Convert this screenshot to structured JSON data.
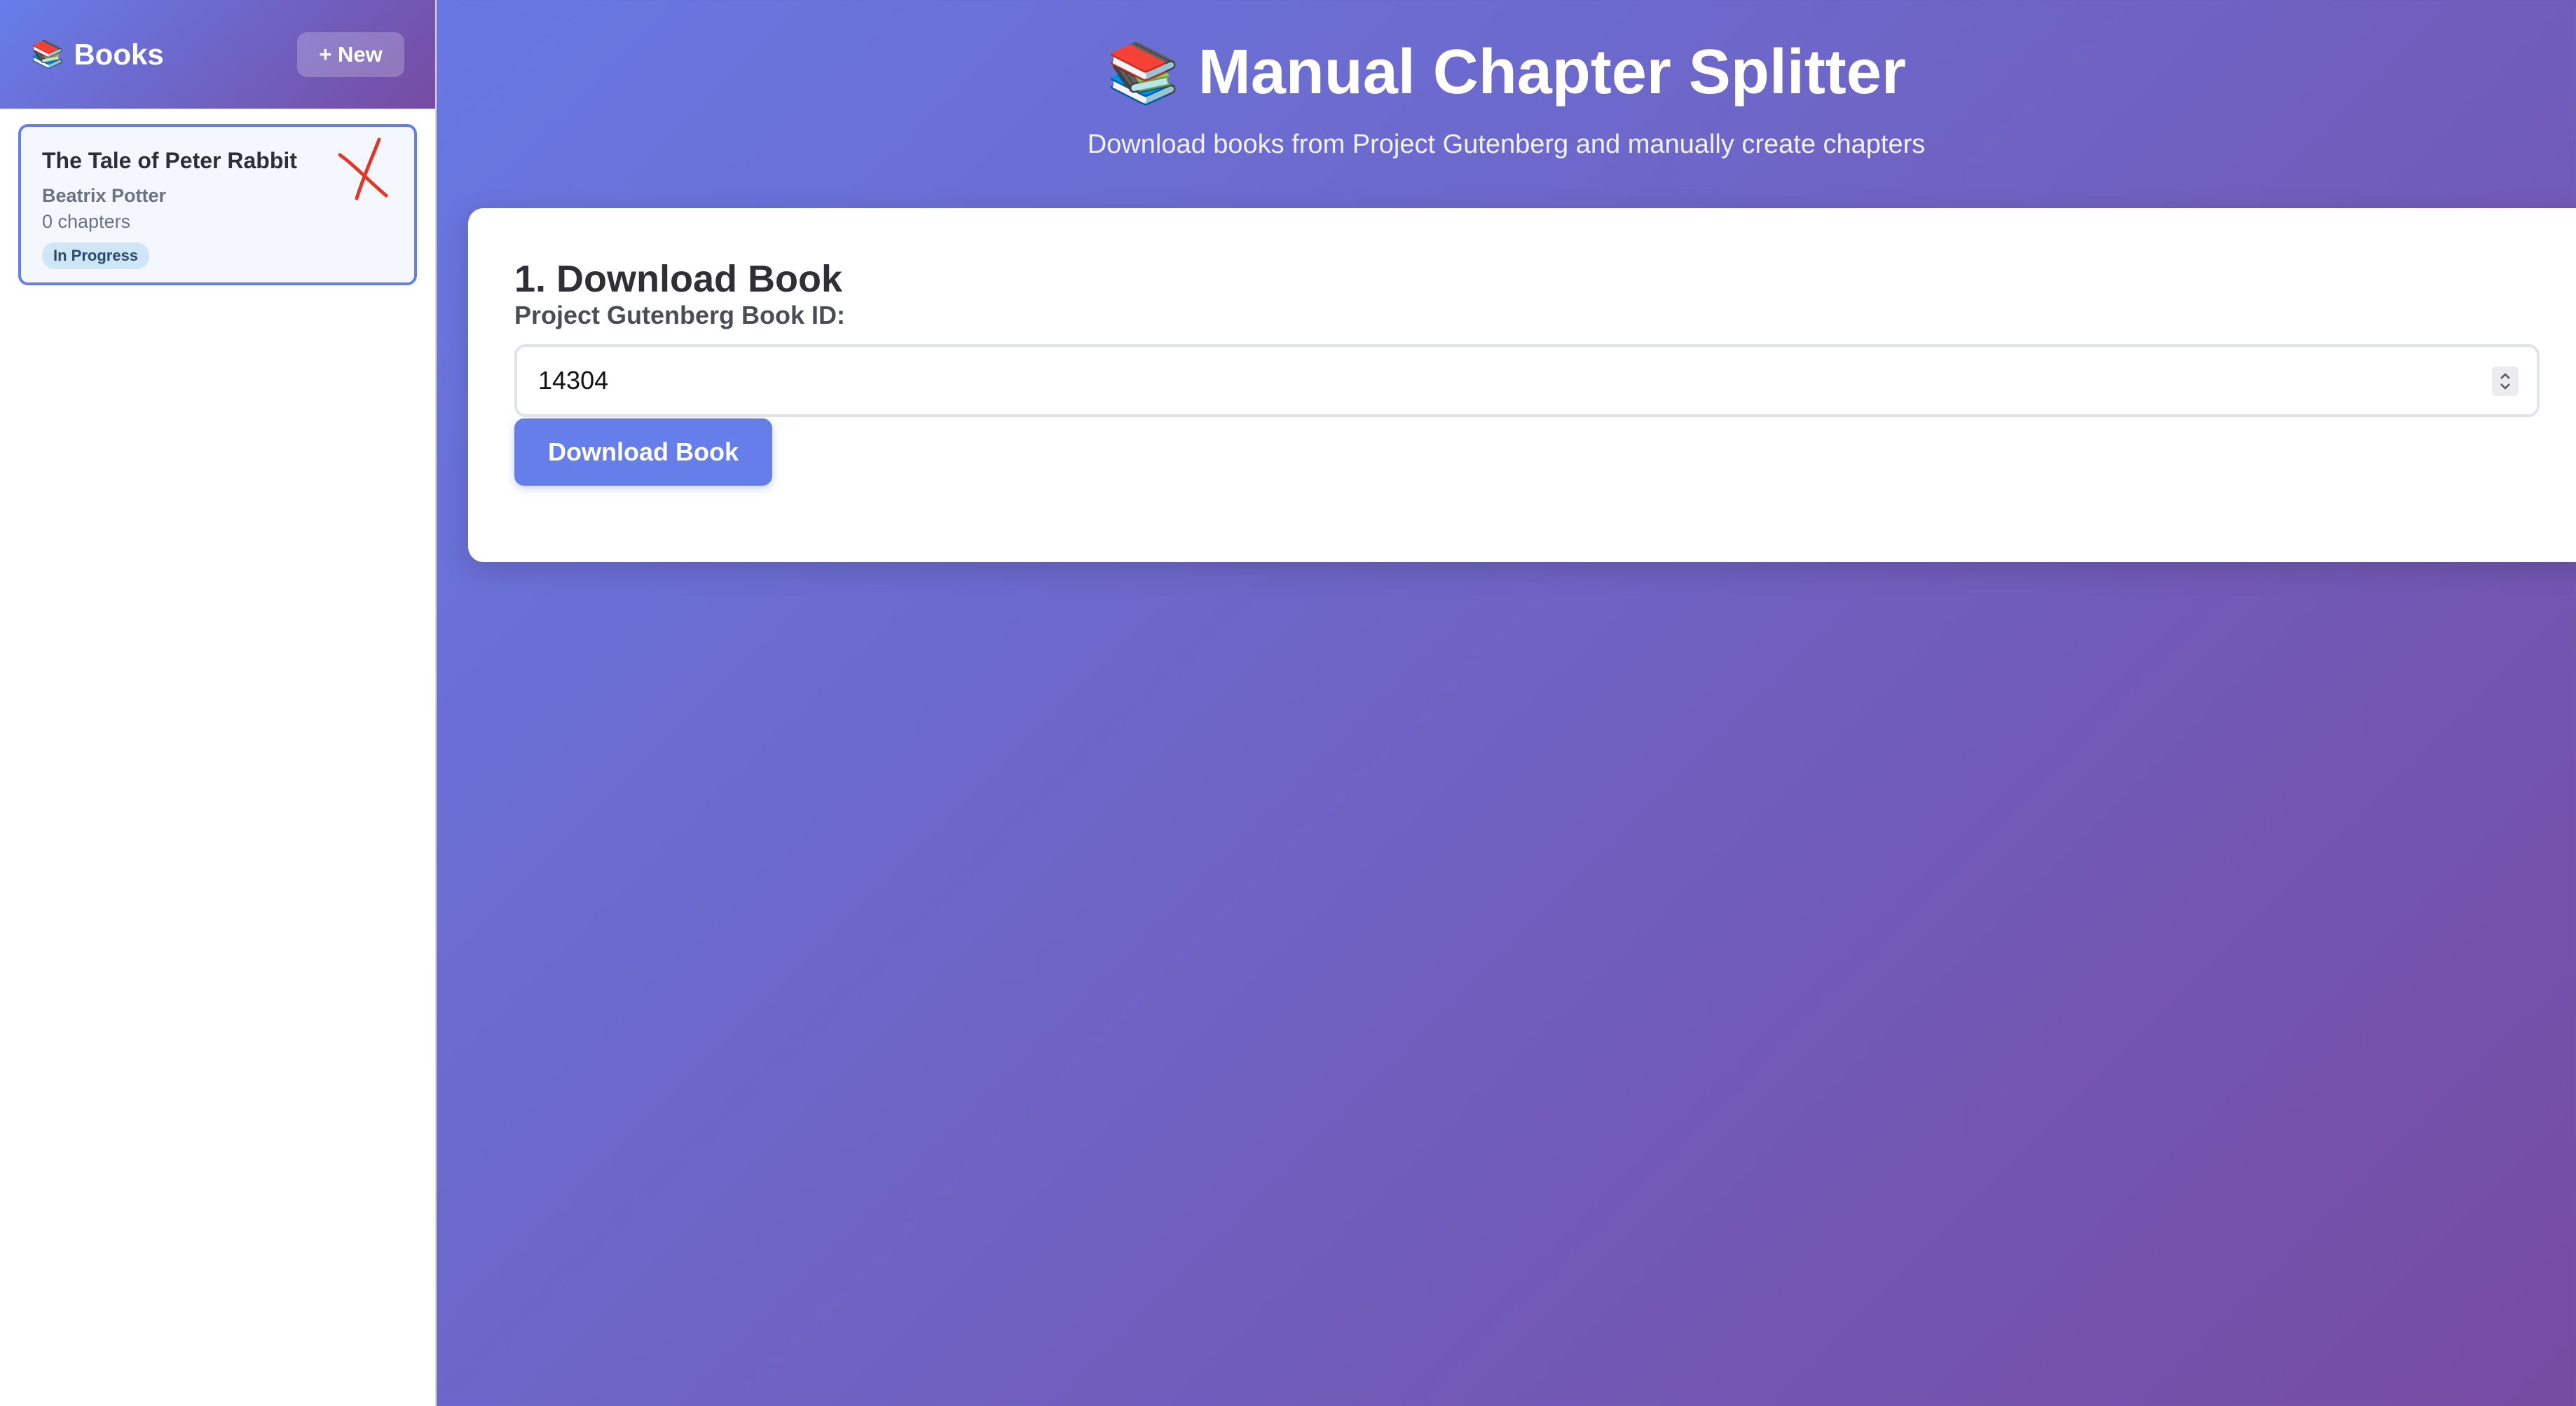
{
  "sidebar": {
    "title": "Books",
    "title_icon": "books-icon",
    "new_button_label": "+ New",
    "books": [
      {
        "title": "The Tale of Peter Rabbit",
        "author": "Beatrix Potter",
        "chapters": "0 chapters",
        "status": "In Progress",
        "selected": true
      }
    ]
  },
  "main": {
    "title": "Manual Chapter Splitter",
    "title_icon": "books-icon",
    "subtitle": "Download books from Project Gutenberg and manually create chapters",
    "download_section": {
      "heading": "1. Download Book",
      "field_label": "Project Gutenberg Book ID:",
      "book_id_value": "14304",
      "button_label": "Download Book"
    }
  },
  "colors": {
    "accent": "#667eea",
    "gradient_end": "#764ba2",
    "status_badge_bg": "#cfe6f7",
    "delete_mark": "#e0392b"
  }
}
